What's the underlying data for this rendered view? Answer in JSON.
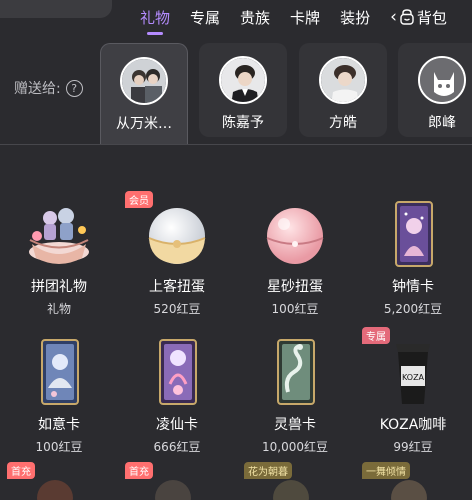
{
  "tabs": [
    {
      "label": "礼物",
      "active": true
    },
    {
      "label": "专属",
      "active": false
    },
    {
      "label": "贵族",
      "active": false
    },
    {
      "label": "卡牌",
      "active": false
    },
    {
      "label": "装扮",
      "active": false
    }
  ],
  "tab_scroll_icon": "chevron-left-icon",
  "bag": {
    "icon": "bag-icon",
    "label": "背包"
  },
  "recipients": {
    "label": "赠送给:",
    "help_icon": "help-icon",
    "help_glyph": "?",
    "list": [
      {
        "name": "从万米…",
        "selected": true
      },
      {
        "name": "陈嘉予",
        "selected": false
      },
      {
        "name": "方皓",
        "selected": false
      },
      {
        "name": "郎峰",
        "selected": false
      }
    ]
  },
  "gifts": [
    {
      "name": "拼团礼物",
      "price": "礼物",
      "badge": ""
    },
    {
      "name": "上客扭蛋",
      "price": "520红豆",
      "badge": "会员"
    },
    {
      "name": "星砂扭蛋",
      "price": "100红豆",
      "badge": ""
    },
    {
      "name": "钟情卡",
      "price": "5,200红豆",
      "badge": ""
    },
    {
      "name": "如意卡",
      "price": "100红豆",
      "badge": ""
    },
    {
      "name": "凌仙卡",
      "price": "666红豆",
      "badge": ""
    },
    {
      "name": "灵兽卡",
      "price": "10,000红豆",
      "badge": ""
    },
    {
      "name": "KOZA咖啡",
      "price": "99红豆",
      "badge": "专属"
    }
  ],
  "bottom_badges": [
    "首充",
    "首充",
    "花为朝暮",
    "一舞倾情"
  ],
  "colors": {
    "accent": "#b58cff",
    "background": "#2b2b2f",
    "badge": "#ff6f6f"
  }
}
